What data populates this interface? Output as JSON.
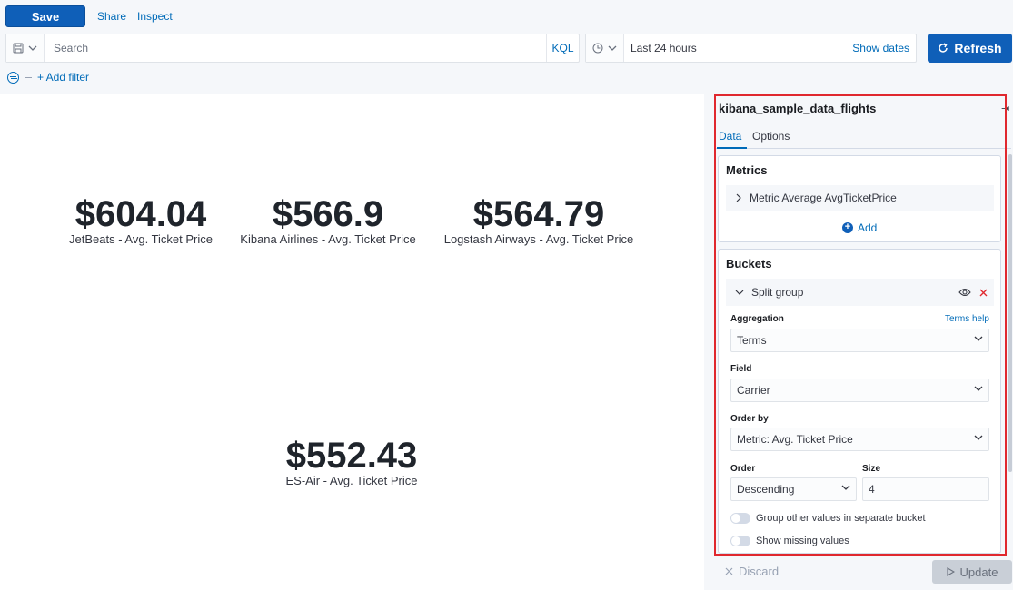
{
  "toolbar": {
    "save_label": "Save",
    "share_label": "Share",
    "inspect_label": "Inspect"
  },
  "search": {
    "placeholder": "Search",
    "language": "KQL"
  },
  "time": {
    "range_label": "Last 24 hours",
    "show_dates_label": "Show dates",
    "refresh_label": "Refresh"
  },
  "filters": {
    "add_filter_label": "+ Add filter"
  },
  "metrics": [
    {
      "value": "$604.04",
      "label": "JetBeats - Avg. Ticket Price"
    },
    {
      "value": "$566.9",
      "label": "Kibana Airlines - Avg. Ticket Price"
    },
    {
      "value": "$564.79",
      "label": "Logstash Airways - Avg. Ticket Price"
    },
    {
      "value": "$552.43",
      "label": "ES-Air - Avg. Ticket Price"
    }
  ],
  "panel": {
    "index_title": "kibana_sample_data_flights",
    "tabs": [
      "Data",
      "Options"
    ],
    "active_tab": "Data",
    "metrics_section": {
      "title": "Metrics",
      "items": [
        {
          "label": "Metric Average AvgTicketPrice"
        }
      ],
      "add_label": "Add"
    },
    "buckets_section": {
      "title": "Buckets",
      "item_label": "Split group",
      "aggregation_label": "Aggregation",
      "aggregation_help": "Terms help",
      "aggregation_value": "Terms",
      "field_label": "Field",
      "field_value": "Carrier",
      "order_by_label": "Order by",
      "order_by_value": "Metric: Avg. Ticket Price",
      "order_label": "Order",
      "order_value": "Descending",
      "size_label": "Size",
      "size_value": "4",
      "toggles": [
        {
          "label": "Group other values in separate bucket",
          "enabled": false
        },
        {
          "label": "Show missing values",
          "enabled": false
        }
      ]
    },
    "footer": {
      "discard_label": "Discard",
      "update_label": "Update"
    }
  },
  "colors": {
    "primary": "#0f5fb8",
    "link": "#006bb8",
    "highlight": "#e0282e"
  }
}
